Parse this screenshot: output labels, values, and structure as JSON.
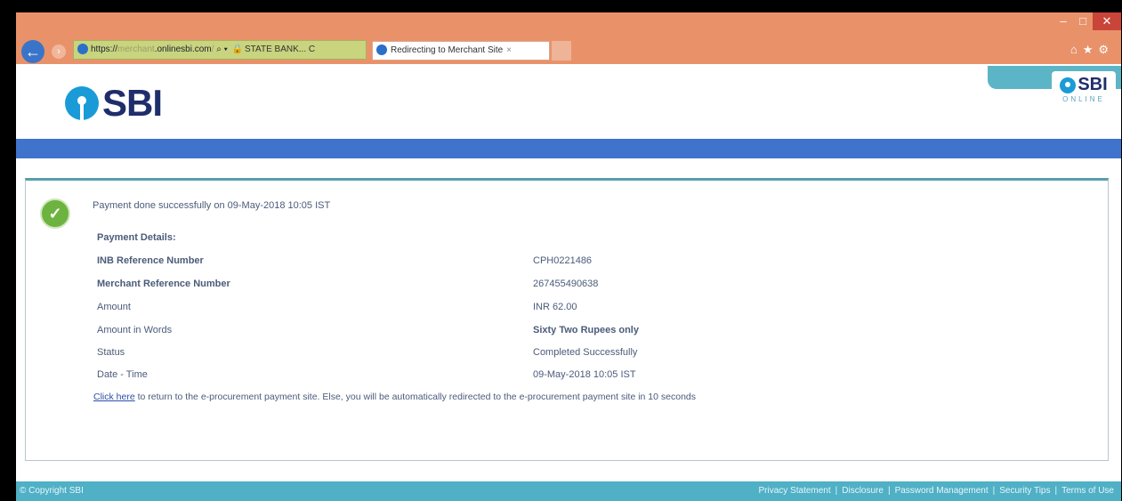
{
  "browser": {
    "url_prefix": "https://",
    "url_obscured": "merchant",
    "url_domain": ".onlinesbi.com",
    "url_suffix": "/ ",
    "search_glyph": "⌕ ▾",
    "site_identity": "STATE BANK... C",
    "tab_title": "Redirecting to Merchant Site",
    "tab_close": "×",
    "back_icon": "←",
    "forward_icon": "›",
    "window_controls": [
      "–",
      "□",
      "✕"
    ],
    "toolbar_icons": [
      "⌂",
      "★",
      "⚙"
    ]
  },
  "header": {
    "logo_text": "SBI",
    "online_logo_text": "SBI",
    "online_logo_sub": "ONLINE"
  },
  "payment": {
    "success_message": "Payment done successfully on 09-May-2018 10:05 IST",
    "details_heading": "Payment Details:",
    "rows": [
      {
        "label": "INB Reference Number",
        "value": "CPH0221486"
      },
      {
        "label": "Merchant Reference Number",
        "value": "267455490638"
      },
      {
        "label": "Amount",
        "value": "INR 62.00"
      },
      {
        "label": "Amount in Words",
        "value": "Sixty Two Rupees only"
      },
      {
        "label": "Status",
        "value": "Completed Successfully"
      },
      {
        "label": "Date - Time",
        "value": "09-May-2018 10:05 IST"
      }
    ],
    "click_here": "Click here",
    "redirect_text": " to return to the e-procurement payment site. Else, you will be automatically redirected to the e-procurement payment site in 10 seconds"
  },
  "footer": {
    "copyright": "© Copyright SBI",
    "links": [
      "Privacy Statement",
      "Disclosure",
      "Password Management",
      "Security Tips",
      "Terms of Use"
    ]
  },
  "colors": {
    "chrome": "#e9926a",
    "nav_bar": "#3f73cc",
    "footer": "#4fb0c6",
    "sbi_blue": "#1a9bd7",
    "sbi_navy": "#1f2d6b",
    "success_green": "#6cb33f"
  }
}
